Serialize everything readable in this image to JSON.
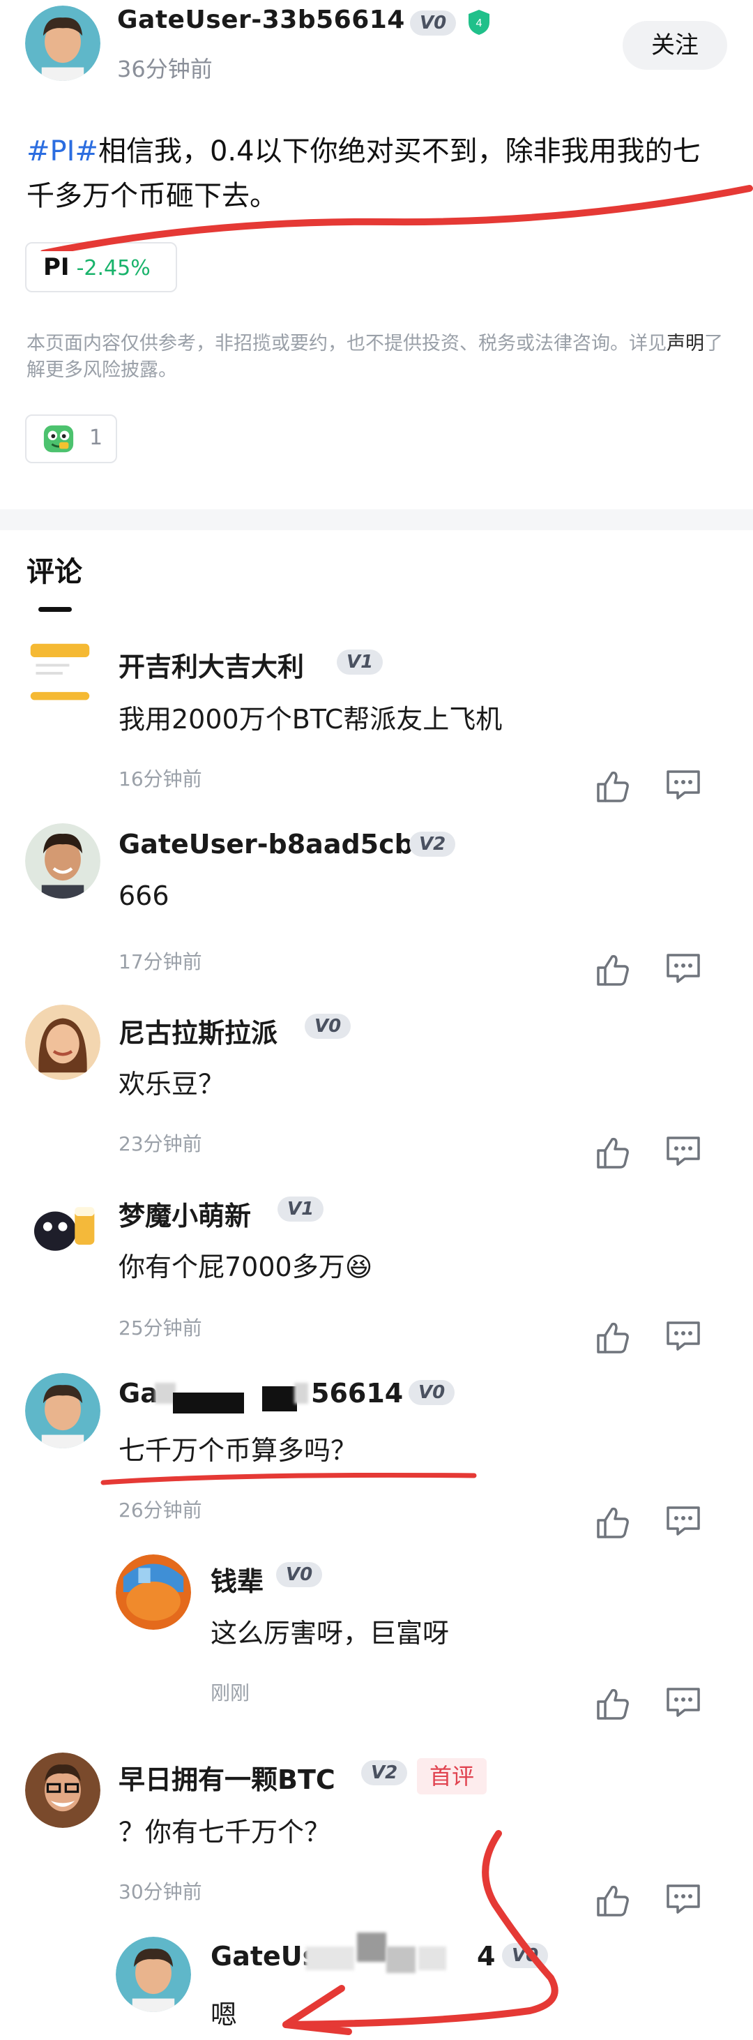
{
  "post": {
    "author": "GateUser-33b56614",
    "level": "V0",
    "shield_level": "4",
    "time": "36分钟前",
    "follow_label": "关注",
    "hashtag": "#PI#",
    "text": "相信我，0.4以下你绝对买不到，除非我用我的七千多万个币砸下去。",
    "coin": {
      "symbol": "PI",
      "change": "-2.45%"
    },
    "disclaimer_before": "本页面内容仅供参考，非招揽或要约，也不提供投资、税务或法律咨询。详见",
    "disclaimer_link": "声明",
    "disclaimer_after": "了解更多风险披露。",
    "reaction_count": "1"
  },
  "comments_title": "评论",
  "comments": [
    {
      "name": "开吉利大吉大利",
      "level": "V1",
      "text": "我用2000万个BTC帮派友上飞机",
      "time": "16分钟前"
    },
    {
      "name": "GateUser-b8aad5cb",
      "level": "V2",
      "text": "666",
      "time": "17分钟前"
    },
    {
      "name": "尼古拉斯拉派",
      "level": "V0",
      "text": "欢乐豆？",
      "time": "23分钟前"
    },
    {
      "name": "梦魔小萌新",
      "level": "V1",
      "text": "你有个屁7000多万",
      "emoji": "😆",
      "time": "25分钟前"
    },
    {
      "name_prefix": "Ga",
      "name_suffix": "56614",
      "level": "V0",
      "text": "七千万个币算多吗？",
      "time": "26分钟前"
    },
    {
      "name": "钱辈",
      "level": "V0",
      "text": "这么厉害呀，巨富呀",
      "time": "刚刚"
    },
    {
      "name": "早日拥有一颗BTC",
      "level": "V2",
      "tag": "首评",
      "text": "？你有七千万个？",
      "time": "30分钟前"
    },
    {
      "name_prefix": "GateUs",
      "name_suffix": "4",
      "level": "V0",
      "text": "嗯"
    }
  ],
  "colors": {
    "hashtag": "#2b6de0",
    "positive_change": "#19b36b",
    "first_tag": "#e0424f",
    "annotation_red": "#e53935"
  },
  "icons": [
    "thumbs-up-icon",
    "comment-icon",
    "shield-icon",
    "frog-emoji-icon"
  ]
}
